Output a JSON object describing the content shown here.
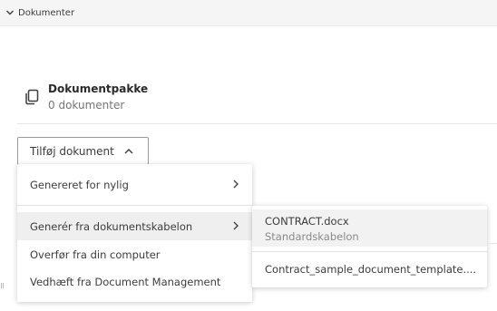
{
  "section": {
    "title": "Dokumenter",
    "icon": "chevron-down-icon"
  },
  "package": {
    "name": "Dokumentpakke",
    "count": "0 dokumenter",
    "icon": "copy-document-icon"
  },
  "add_button": {
    "label": "Tilføj dokument",
    "icon": "chevron-up-icon"
  },
  "menu": {
    "items": [
      {
        "label": "Genereret for nylig",
        "has_submenu": true
      },
      {
        "label": "Generér fra dokumentskabelon",
        "has_submenu": true,
        "active": true
      },
      {
        "label": "Overfør fra din computer",
        "has_submenu": false
      },
      {
        "label": "Vedhæft fra Document Management",
        "has_submenu": false
      }
    ]
  },
  "submenu": {
    "items": [
      {
        "name": "CONTRACT.docx",
        "template": "Standardskabelon"
      },
      {
        "name": "Contract_sample_document_template...."
      }
    ]
  },
  "colors": {
    "text": "#3c3c3c",
    "muted": "#757575",
    "header_bg": "#f5f5f5",
    "hover_bg": "#efefef"
  }
}
